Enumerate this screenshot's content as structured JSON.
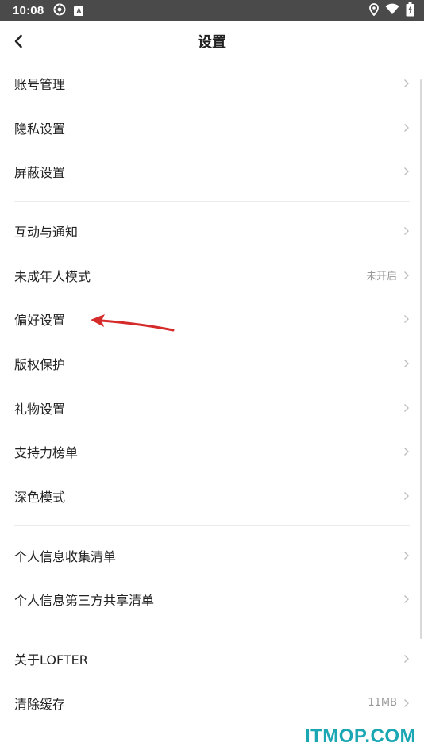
{
  "status_bar": {
    "time": "10:08",
    "app_icon_letter": "A",
    "icons": [
      "sync-icon",
      "a-box-icon",
      "location-icon",
      "wifi-icon",
      "battery-charging-icon"
    ]
  },
  "nav": {
    "title": "设置",
    "back_icon": "chevron-left-icon"
  },
  "groups": [
    {
      "items": [
        {
          "label": "账号管理",
          "value": ""
        },
        {
          "label": "隐私设置",
          "value": ""
        },
        {
          "label": "屏蔽设置",
          "value": ""
        }
      ]
    },
    {
      "items": [
        {
          "label": "互动与通知",
          "value": ""
        },
        {
          "label": "未成年人模式",
          "value": "未开启"
        },
        {
          "label": "偏好设置",
          "value": ""
        },
        {
          "label": "版权保护",
          "value": ""
        },
        {
          "label": "礼物设置",
          "value": ""
        },
        {
          "label": "支持力榜单",
          "value": ""
        },
        {
          "label": "深色模式",
          "value": ""
        }
      ]
    },
    {
      "items": [
        {
          "label": "个人信息收集清单",
          "value": ""
        },
        {
          "label": "个人信息第三方共享清单",
          "value": ""
        }
      ]
    },
    {
      "items": [
        {
          "label": "关于LOFTER",
          "value": ""
        },
        {
          "label": "清除缓存",
          "value": "11MB"
        }
      ]
    }
  ],
  "colors": {
    "status_bar": "#4a4a4a",
    "text_primary": "#222222",
    "text_secondary": "#999999",
    "chevron": "#bdbdbd",
    "divider": "#ececec",
    "annotation_arrow": "#d62b2b",
    "watermark": "#1aa7b3"
  },
  "watermark": {
    "text": "ITMOP.COM"
  }
}
